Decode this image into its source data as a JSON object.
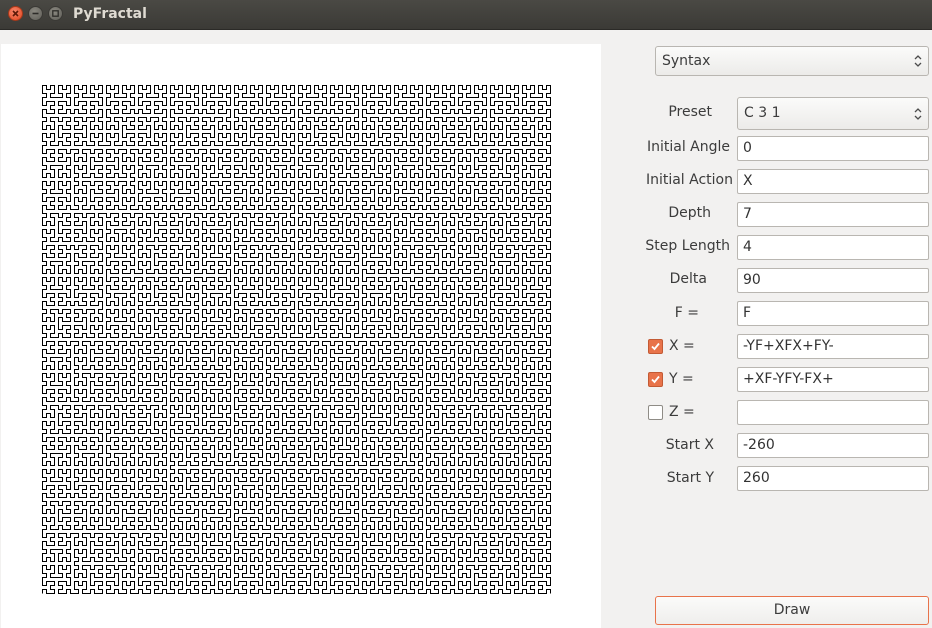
{
  "window": {
    "title": "PyFractal"
  },
  "syntax_combo": {
    "value": "Syntax"
  },
  "form": {
    "preset": {
      "label": "Preset",
      "value": "C 3 1"
    },
    "initial_angle": {
      "label": "Initial Angle",
      "value": "0"
    },
    "initial_action": {
      "label": "Initial Action",
      "value": "X"
    },
    "depth": {
      "label": "Depth",
      "value": "7"
    },
    "step_length": {
      "label": "Step Length",
      "value": "4"
    },
    "delta": {
      "label": "Delta",
      "value": "90"
    },
    "f_rule": {
      "label": "F =",
      "value": "F"
    },
    "x_rule": {
      "label": "X =",
      "value": "-YF+XFX+FY-",
      "checked": true
    },
    "y_rule": {
      "label": "Y =",
      "value": "+XF-YFY-FX+",
      "checked": true
    },
    "z_rule": {
      "label": "Z =",
      "value": "",
      "checked": false
    },
    "start_x": {
      "label": "Start X",
      "value": "-260"
    },
    "start_y": {
      "label": "Start Y",
      "value": "260"
    }
  },
  "draw_button": {
    "label": "Draw"
  },
  "colors": {
    "accent": "#e8734a",
    "titlebar": "#3c3b37",
    "background": "#f2f1f0"
  }
}
